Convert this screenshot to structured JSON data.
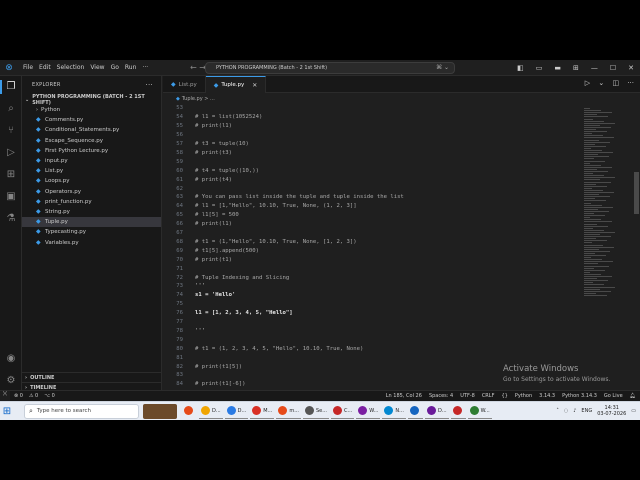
{
  "titlebar": {
    "menu": [
      "File",
      "Edit",
      "Selection",
      "View",
      "Go",
      "Run"
    ],
    "more": "···",
    "command_center": "PYTHON PROGRAMMING (Batch - 2 1st Shift)"
  },
  "sidebar": {
    "title": "EXPLORER",
    "more": "···",
    "folder": "PYTHON PROGRAMMING (BATCH - 2 1ST SHIFT)",
    "items": [
      {
        "label": "Python",
        "type": "folder"
      },
      {
        "label": "Comments.py",
        "type": "py"
      },
      {
        "label": "Conditional_Statements.py",
        "type": "py"
      },
      {
        "label": "Escape_Sequence.py",
        "type": "py"
      },
      {
        "label": "First Python Lecture.py",
        "type": "py"
      },
      {
        "label": "input.py",
        "type": "py"
      },
      {
        "label": "List.py",
        "type": "py"
      },
      {
        "label": "Loops.py",
        "type": "py"
      },
      {
        "label": "Operators.py",
        "type": "py"
      },
      {
        "label": "print_function.py",
        "type": "py"
      },
      {
        "label": "String.py",
        "type": "py"
      },
      {
        "label": "Tuple.py",
        "type": "py",
        "selected": true
      },
      {
        "label": "Typecasting.py",
        "type": "py"
      },
      {
        "label": "Variables.py",
        "type": "py"
      }
    ],
    "outline": "OUTLINE",
    "timeline": "TIMELINE"
  },
  "tabs": [
    {
      "label": "List.py",
      "active": false
    },
    {
      "label": "Tuple.py",
      "active": true
    }
  ],
  "breadcrumb": "Tuple.py > ...",
  "editor": {
    "lines": [
      {
        "n": "53",
        "text": "",
        "kind": "code"
      },
      {
        "n": "54",
        "text": "# l1 = list(1052524)",
        "kind": "comment"
      },
      {
        "n": "55",
        "text": "# print(l1)",
        "kind": "comment"
      },
      {
        "n": "56",
        "text": "",
        "kind": "code"
      },
      {
        "n": "57",
        "text": "# t3 = tuple(10)",
        "kind": "comment"
      },
      {
        "n": "58",
        "text": "# print(t3)",
        "kind": "comment"
      },
      {
        "n": "59",
        "text": "",
        "kind": "code"
      },
      {
        "n": "60",
        "text": "# t4 = tuple((10,))",
        "kind": "comment"
      },
      {
        "n": "61",
        "text": "# print(t4)",
        "kind": "comment"
      },
      {
        "n": "62",
        "text": "",
        "kind": "code"
      },
      {
        "n": "63",
        "text": "# You can pass list inside the tuple and tuple inside the list",
        "kind": "comment"
      },
      {
        "n": "64",
        "text": "# l1 = [1,\"Hello\", 10.10, True, None, (1, 2, 3]]",
        "kind": "comment"
      },
      {
        "n": "65",
        "text": "# l1[5] = 500",
        "kind": "comment"
      },
      {
        "n": "66",
        "text": "# print(l1)",
        "kind": "comment"
      },
      {
        "n": "67",
        "text": "",
        "kind": "code"
      },
      {
        "n": "68",
        "text": "# t1 = (1,\"Hello\", 10.10, True, None, [1, 2, 3])",
        "kind": "comment"
      },
      {
        "n": "69",
        "text": "# t1[5].append(500)",
        "kind": "comment"
      },
      {
        "n": "70",
        "text": "# print(t1)",
        "kind": "comment"
      },
      {
        "n": "71",
        "text": "",
        "kind": "code"
      },
      {
        "n": "72",
        "text": "# Tuple Indexing and Slicing",
        "kind": "comment"
      },
      {
        "n": "73",
        "text": "'''",
        "kind": "code"
      },
      {
        "n": "74",
        "text": "s1 = 'Hello'",
        "kind": "bold"
      },
      {
        "n": "75",
        "text": "",
        "kind": "code"
      },
      {
        "n": "76",
        "text": "l1 = [1, 2, 3, 4, 5, \"Hello\"]",
        "kind": "bold"
      },
      {
        "n": "77",
        "text": "",
        "kind": "code"
      },
      {
        "n": "78",
        "text": "'''",
        "kind": "code"
      },
      {
        "n": "79",
        "text": "",
        "kind": "code"
      },
      {
        "n": "80",
        "text": "# t1 = (1, 2, 3, 4, 5, \"Hello\", 10.10, True, None)",
        "kind": "comment"
      },
      {
        "n": "81",
        "text": "",
        "kind": "code"
      },
      {
        "n": "82",
        "text": "# print(t1[5])",
        "kind": "comment"
      },
      {
        "n": "83",
        "text": "",
        "kind": "code"
      },
      {
        "n": "84",
        "text": "# print(t1[-6])",
        "kind": "comment"
      }
    ]
  },
  "watermark": {
    "title": "Activate Windows",
    "subtitle": "Go to Settings to activate Windows."
  },
  "statusbar": {
    "errors": "⊗ 0",
    "warnings": "⚠ 0",
    "ports": "⌥ 0",
    "position": "Ln 185, Col 26",
    "spaces": "Spaces: 4",
    "encoding": "UTF-8",
    "eol": "CRLF",
    "lang_braces": "{}",
    "language": "Python",
    "version": "3.14.3",
    "interpreter": "Python 3.14.3",
    "golive": "Go Live"
  },
  "taskbar": {
    "search_placeholder": "Type here to search",
    "apps": [
      {
        "label": "",
        "color": "#e64a19",
        "open": false
      },
      {
        "label": "D...",
        "color": "#f0a500",
        "open": true
      },
      {
        "label": "D...",
        "color": "#2a7be4",
        "open": true
      },
      {
        "label": "M...",
        "color": "#d93025",
        "open": true
      },
      {
        "label": "m...",
        "color": "#e64a19",
        "open": true
      },
      {
        "label": "Se...",
        "color": "#555555",
        "open": true
      },
      {
        "label": "C...",
        "color": "#c62828",
        "open": true
      },
      {
        "label": "W...",
        "color": "#7b1fa2",
        "open": true
      },
      {
        "label": "N...",
        "color": "#0288d1",
        "open": true
      },
      {
        "label": "",
        "color": "#1565c0",
        "open": true
      },
      {
        "label": "D...",
        "color": "#6a1b9a",
        "open": true
      },
      {
        "label": "",
        "color": "#c62828",
        "open": true
      },
      {
        "label": "W...",
        "color": "#2e7d32",
        "open": true
      }
    ],
    "lang": "ENG",
    "time": "14:31",
    "date": "03-07-2026"
  },
  "colors": {
    "accent": "#3c9be8",
    "editor_bg": "#1f1f1f",
    "sidebar_bg": "#181818"
  }
}
